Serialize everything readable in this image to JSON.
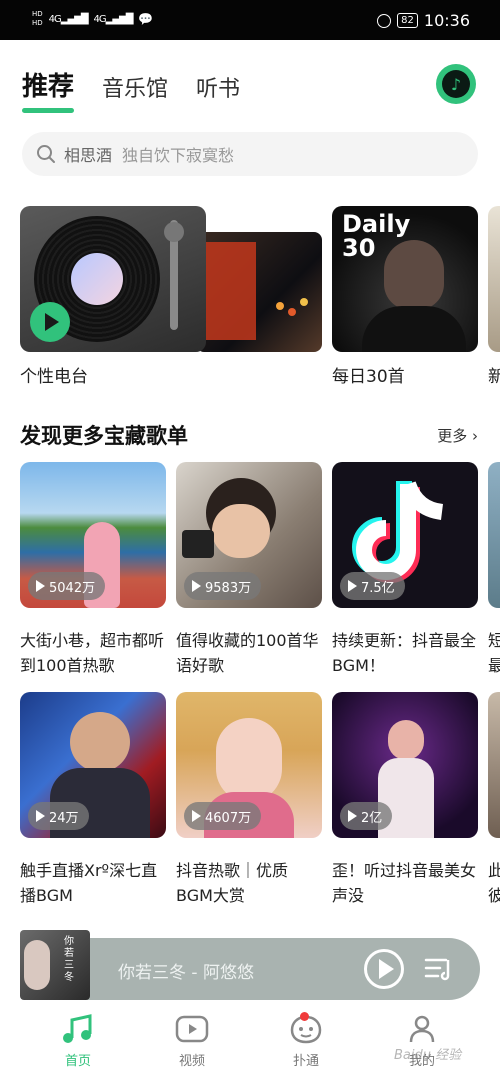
{
  "status": {
    "left": "HD 4G 4G",
    "battery": "82",
    "time": "10:36"
  },
  "tabs": [
    {
      "label": "推荐",
      "active": true
    },
    {
      "label": "音乐馆",
      "active": false
    },
    {
      "label": "听书",
      "active": false
    }
  ],
  "search": {
    "keyword": "相思酒",
    "hint": "独自饮下寂寞愁"
  },
  "features": [
    {
      "label": "个性电台"
    },
    {
      "label": "每日30首",
      "cover_text": "Daily 30"
    },
    {
      "label": "新"
    }
  ],
  "section": {
    "title": "发现更多宝藏歌单",
    "more": "更多"
  },
  "playlists": [
    {
      "title": "大街小巷，超市都听到100首热歌",
      "count": "5042万"
    },
    {
      "title": "值得收藏的100首华语好歌",
      "count": "9583万"
    },
    {
      "title": "持续更新：抖音最全BGM！",
      "count": "7.5亿"
    },
    {
      "title": "短最",
      "count": ""
    },
    {
      "title": "触手直播Xrº深七直播BGM",
      "count": "24万"
    },
    {
      "title": "抖音热歌｜优质BGM大赏",
      "count": "4607万"
    },
    {
      "title": "歪！听过抖音最美女声没",
      "count": "2亿"
    },
    {
      "title": "此彼",
      "count": ""
    }
  ],
  "mini_player": {
    "track": "你若三冬 - 阿悠悠",
    "cover_text": "你若三冬"
  },
  "nav": [
    {
      "label": "首页",
      "icon": "music-note-icon",
      "active": true
    },
    {
      "label": "视频",
      "icon": "video-icon",
      "active": false
    },
    {
      "label": "扑通",
      "icon": "face-icon",
      "active": false,
      "badge": true
    },
    {
      "label": "我的",
      "icon": "person-icon",
      "active": false
    }
  ],
  "watermark": "Baidu 经验",
  "colors": {
    "accent": "#31c27c",
    "badge": "#f03b3b"
  }
}
